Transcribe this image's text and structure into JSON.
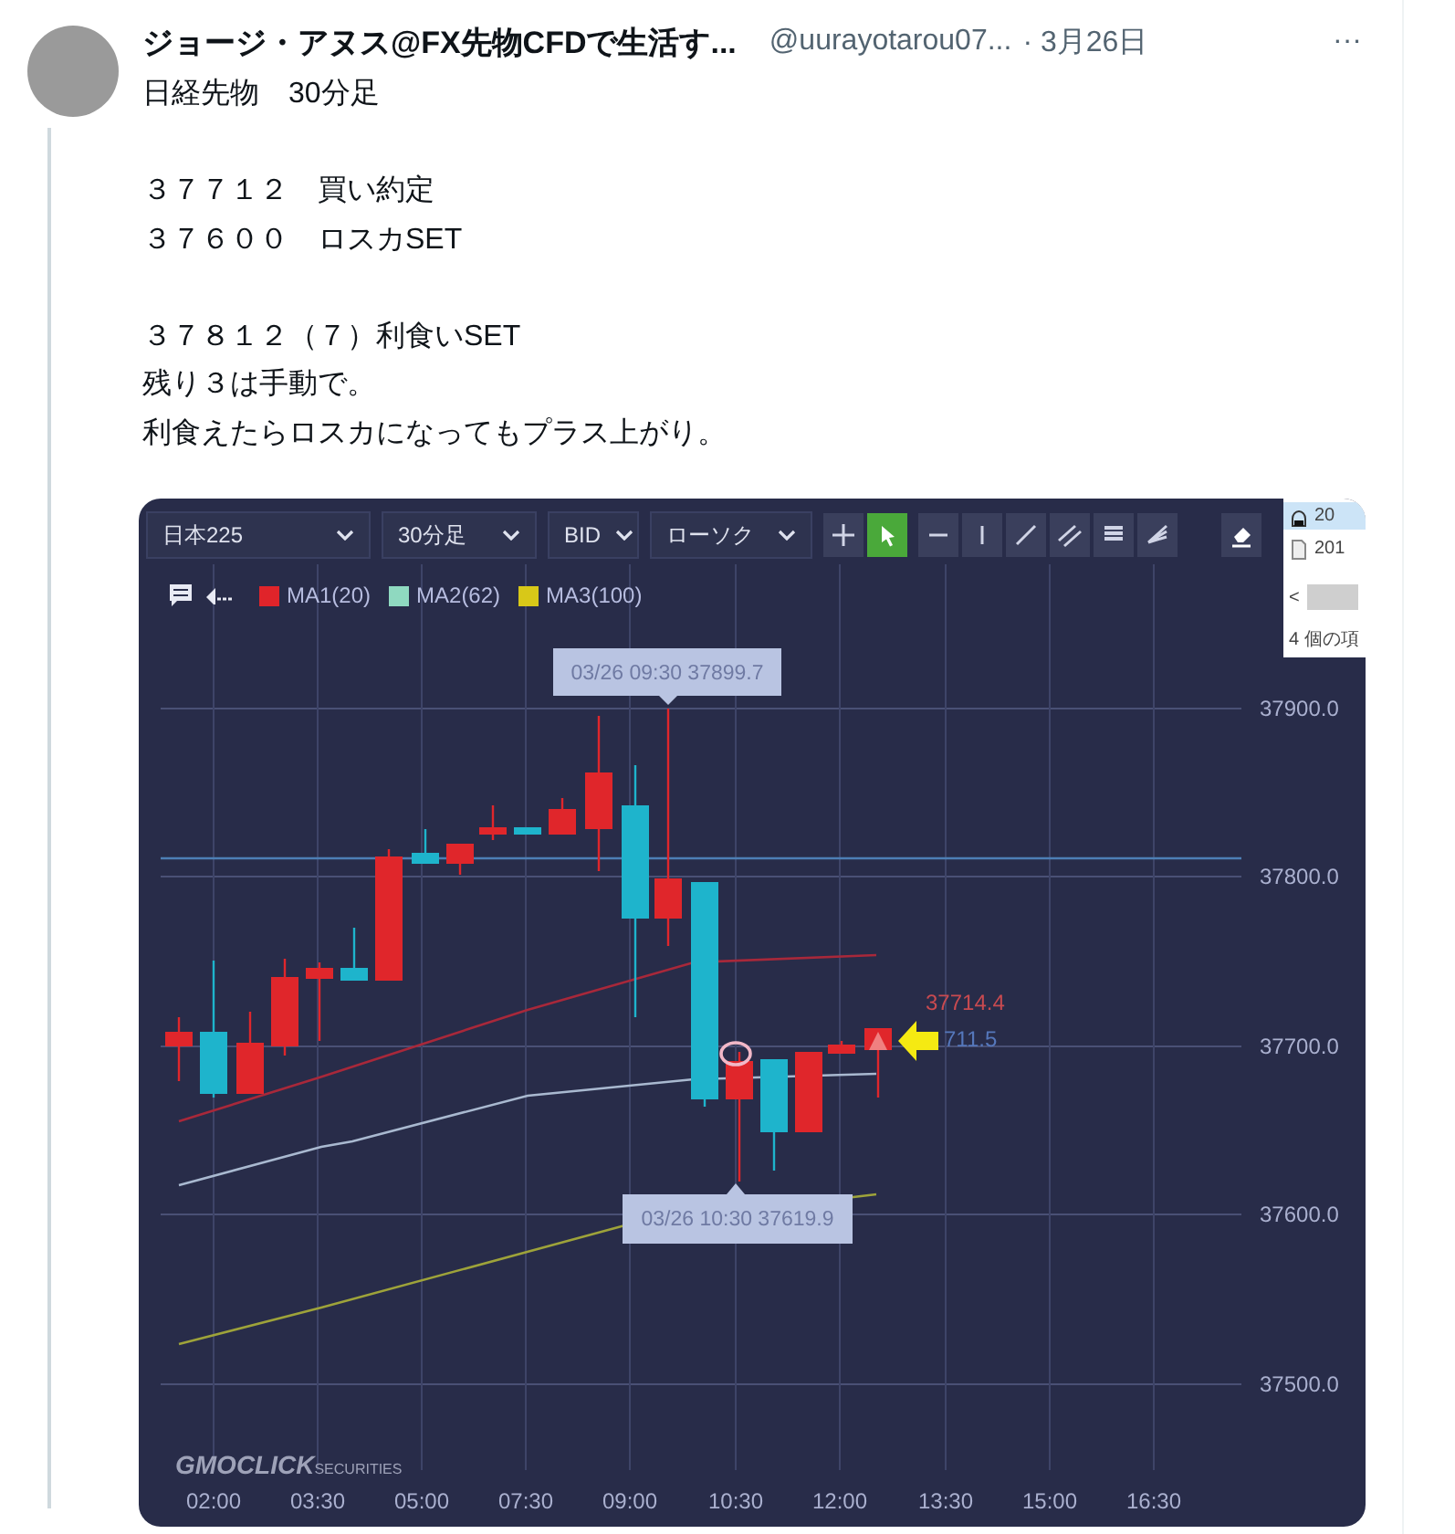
{
  "tweet": {
    "author_name": "ジョージ・アヌス@FX先物CFDで生活す...",
    "handle": "@uurayotarou07...",
    "date": "· 3月26日",
    "more": "···",
    "paragraphs": [
      [
        "日経先物　30分足"
      ],
      [
        "３７７１２　買い約定",
        "３７６００　ロスカSET"
      ],
      [
        "３７８１２（７）利食いSET",
        "残り３は手動で。",
        "利食えたらロスカになってもプラス上がり。"
      ]
    ]
  },
  "chart": {
    "dropdowns": [
      {
        "label": "日本225"
      },
      {
        "label": "30分足"
      },
      {
        "label": "BID"
      },
      {
        "label": "ローソク"
      }
    ],
    "tools": [
      {
        "kind": "crosshair",
        "selected": false
      },
      {
        "kind": "pointer",
        "selected": true
      },
      {
        "kind": "hline",
        "selected": false
      },
      {
        "kind": "vline",
        "selected": false
      },
      {
        "kind": "trendline",
        "selected": false
      },
      {
        "kind": "channel",
        "selected": false
      },
      {
        "kind": "retracement",
        "selected": false
      },
      {
        "kind": "fan",
        "selected": false
      },
      {
        "kind": "eraser",
        "selected": false
      }
    ],
    "legend": [
      {
        "label": "MA1(20)",
        "color": "#e0242a"
      },
      {
        "label": "MA2(62)",
        "color": "#8fd9c0"
      },
      {
        "label": "MA3(100)",
        "color": "#d8c818"
      }
    ],
    "price_labels": [
      "37900.0",
      "37800.0",
      "37700.0",
      "37600.0",
      "37500.0"
    ],
    "time_labels": [
      "02:00",
      "03:30",
      "05:00",
      "07:30",
      "09:00",
      "10:30",
      "12:00",
      "13:30",
      "15:00",
      "16:30"
    ],
    "tooltips": [
      "03/26 09:30 37899.7",
      "03/26 10:30 37619.9"
    ],
    "price_tags": [
      {
        "text": "37714.4",
        "color": "#c84a50"
      },
      {
        "text": "711.5",
        "color": "#5577bb"
      }
    ],
    "logo": {
      "main": "GMOCLICK",
      "sub": "SECURITIES"
    },
    "file_panel": {
      "items": [
        "20",
        "201"
      ],
      "scroll": "<",
      "status": "4 個の項"
    }
  }
}
